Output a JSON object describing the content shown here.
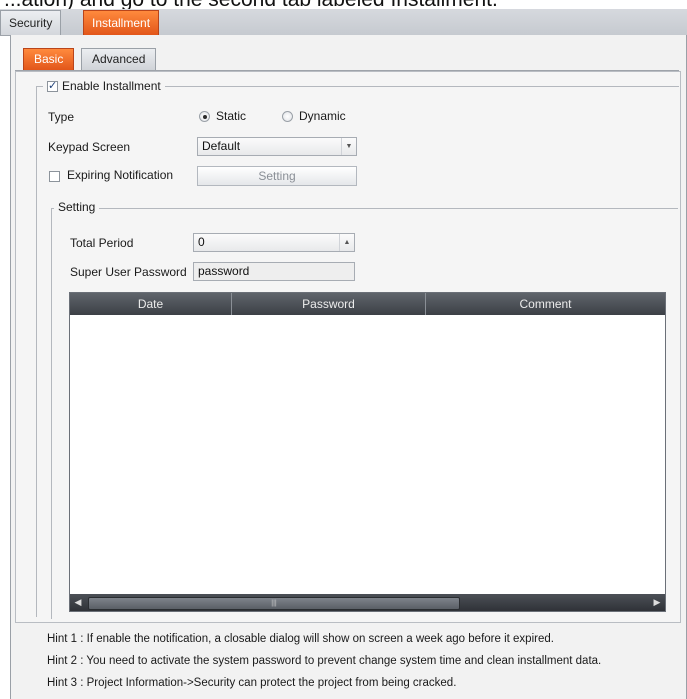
{
  "caption": "...ation) and go to the second tab labeled Installment.",
  "top_tabs": [
    {
      "label": "Security",
      "active": false
    },
    {
      "label": "Installment",
      "active": true
    }
  ],
  "sub_tabs": [
    {
      "label": "Basic",
      "active": true
    },
    {
      "label": "Advanced",
      "active": false
    }
  ],
  "enable_installment": {
    "label": "Enable Installment",
    "checked": true
  },
  "type": {
    "label": "Type",
    "options": [
      {
        "label": "Static",
        "selected": true
      },
      {
        "label": "Dynamic",
        "selected": false
      }
    ]
  },
  "keypad_screen": {
    "label": "Keypad Screen",
    "value": "Default"
  },
  "expiring_notification": {
    "label": "Expiring Notification",
    "checked": false,
    "button_label": "Setting"
  },
  "setting_group": {
    "title": "Setting",
    "total_period": {
      "label": "Total Period",
      "value": "0"
    },
    "super_user_password": {
      "label": "Super User Password",
      "value": "password"
    },
    "table": {
      "columns": [
        "Date",
        "Password",
        "Comment"
      ],
      "rows": []
    }
  },
  "hints": [
    "Hint 1 : If enable the notification, a closable dialog will show on screen a week ago before it expired.",
    "Hint 2 : You need to activate the system password to prevent change system time and clean installment data.",
    "Hint 3 : Project Information->Security can protect the project from being cracked."
  ],
  "colors": {
    "accent_tab": "#e2561a",
    "table_header": "#4a4e55"
  }
}
